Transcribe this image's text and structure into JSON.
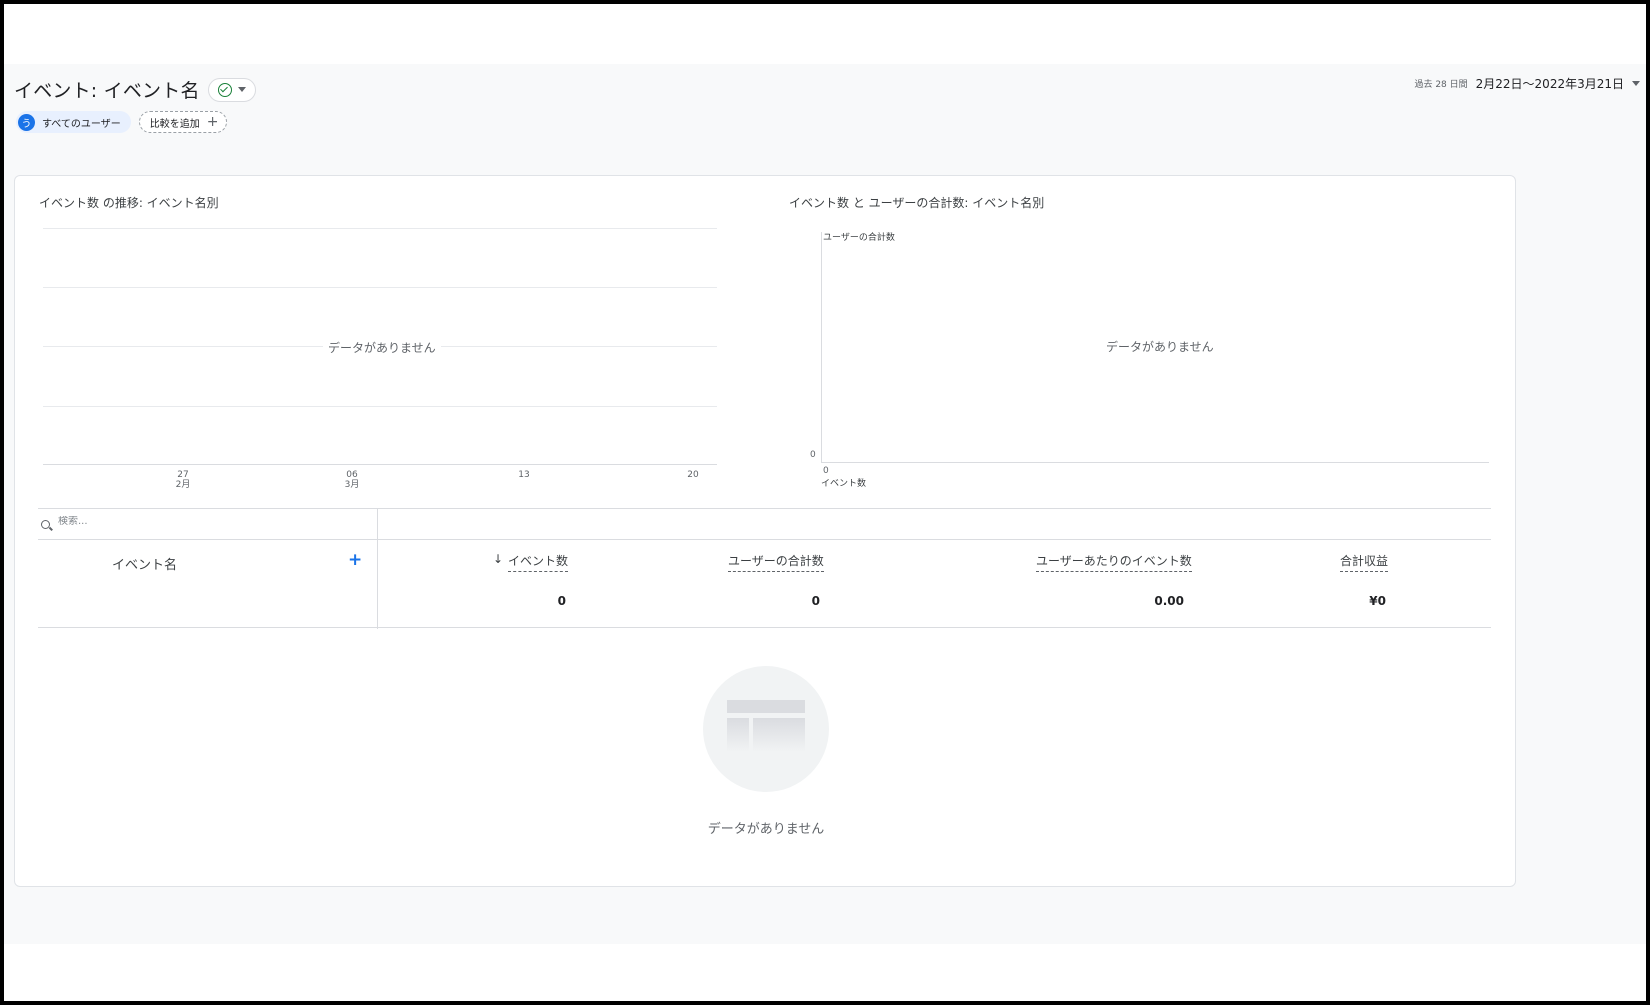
{
  "header": {
    "title": "イベント: イベント名",
    "status_icon": "check-circle-icon",
    "date_prefix": "過去 28 日間",
    "date_range": "2月22日〜2022年3月21日"
  },
  "chips": {
    "user_avatar": "う",
    "user_label": "すべてのユーザー",
    "add_label": "比較を追加"
  },
  "chart1": {
    "title": "イベント数 の推移: イベント名別",
    "no_data": "データがありません",
    "ticks": [
      {
        "day": "27",
        "month": "2月"
      },
      {
        "day": "06",
        "month": "3月"
      },
      {
        "day": "13",
        "month": ""
      },
      {
        "day": "20",
        "month": ""
      }
    ]
  },
  "chart2": {
    "title": "イベント数 と ユーザーの合計数: イベント名別",
    "y_axis_label": "ユーザーの合計数",
    "x_axis_label": "イベント数",
    "y_zero": "0",
    "x_zero": "0",
    "no_data": "データがありません"
  },
  "chart_data": [
    {
      "type": "line",
      "title": "イベント数 の推移: イベント名別",
      "x": [
        "27 2月",
        "06 3月",
        "13",
        "20"
      ],
      "series": [],
      "annotation": "データがありません"
    },
    {
      "type": "scatter",
      "title": "イベント数 と ユーザーの合計数: イベント名別",
      "xlabel": "イベント数",
      "ylabel": "ユーザーの合計数",
      "series": [],
      "annotation": "データがありません"
    }
  ],
  "table": {
    "search_placeholder": "検索...",
    "dimension_header": "イベント名",
    "add_dimension": "+",
    "sort_indicator": "↓",
    "metrics": [
      {
        "label": "イベント数",
        "value": "0"
      },
      {
        "label": "ユーザーの合計数",
        "value": "0"
      },
      {
        "label": "ユーザーあたりのイベント数",
        "value": "0.00"
      },
      {
        "label": "合計収益",
        "value": "¥0"
      }
    ]
  },
  "empty_state": {
    "icon": "empty-table-icon",
    "text": "データがありません"
  },
  "colors": {
    "accent": "#1a73e8",
    "success": "#188038",
    "background": "#f8f9fa"
  }
}
